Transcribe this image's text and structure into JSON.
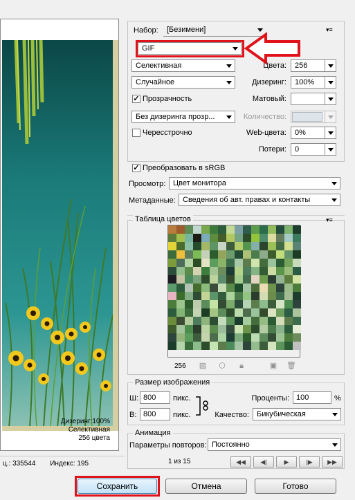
{
  "preview": {
    "dither_text": "Дизеринг:100%",
    "palette_text": "Селективная",
    "colors_text": "256 цвета"
  },
  "status_bar": {
    "left_text": "ц.: 335544",
    "index_text": "Индекс: 195"
  },
  "settings": {
    "preset_label": "Набор:",
    "preset_value": "[Безимени]",
    "format_value": "GIF",
    "reduction_value": "Селективная",
    "colors_label": "Цвета:",
    "colors_value": "256",
    "dither_algo_value": "Случайное",
    "dither_label": "Дизеринг:",
    "dither_value": "100%",
    "transparency_label": "Прозрачность",
    "transparency_checked": "✓",
    "matte_label": "Матовый:",
    "matte_value": "",
    "transp_dither_value": "Без дизеринга прозр...",
    "amount_label": "Количество:",
    "amount_value": "",
    "interlaced_label": "Чересстрочно",
    "interlaced_checked": "",
    "websnap_label": "Web-цвета:",
    "websnap_value": "0%",
    "lossy_label": "Потери:",
    "lossy_value": "0",
    "srgb_label": "Преобразовать в sRGB",
    "srgb_checked": "✓",
    "preview_label": "Просмотр:",
    "preview_value": "Цвет монитора",
    "metadata_label": "Метаданные:",
    "metadata_value": "Сведения об авт. правах и контакты"
  },
  "color_table": {
    "title": "Таблица цветов",
    "count": "256",
    "colors": [
      "#b87c3c",
      "#9c5c2c",
      "#5c8c54",
      "#c0d8d0",
      "#7aa84c",
      "#3c7a3c",
      "#2c5c3c",
      "#c4d898",
      "#7ca0a4",
      "#305c4c",
      "#5c9c4c",
      "#2c6c4c",
      "#94bc5c",
      "#244c3c",
      "#7cb470",
      "#1c3c2c",
      "#5c7c3c",
      "#a4c04c",
      "#78b4a0",
      "#1c1c14",
      "#7cacbc",
      "#5c8c3c",
      "#445c2c",
      "#b4c860",
      "#74a484",
      "#2c4c2c",
      "#94c43c",
      "#4c8c6c",
      "#dcdca0",
      "#647c5c",
      "#a4ccc4",
      "#3c7c5c",
      "#e0d438",
      "#4c6c2c",
      "#8cc0a4",
      "#244c2c",
      "#a4b868",
      "#5c9464",
      "#c8d4c4",
      "#3c5c3c",
      "#b4cc6c",
      "#54944c",
      "#84b0a8",
      "#2c442c",
      "#9cc058",
      "#446c44",
      "#d4e090",
      "#5c8474",
      "#3c6c3c",
      "#ecc03c",
      "#5c7c5c",
      "#7cbc54",
      "#c4d0b8",
      "#2c5c2c",
      "#94a45c",
      "#6c9c6c",
      "#244c34",
      "#acc078",
      "#4c7c4c",
      "#8cac8c",
      "#3c5c2c",
      "#c0dc7c",
      "#64946c",
      "#1c3c24",
      "#7c9c3c",
      "#4c6c5c",
      "#b4d4a4",
      "#2c4c24",
      "#e4e4c4",
      "#5c9c5c",
      "#8cb468",
      "#3c6c4c",
      "#a8c8a8",
      "#5c7c4c",
      "#d0e4b0",
      "#446c3c",
      "#9cc49c",
      "#2c5c34",
      "#74a45c",
      "#c8dcbc",
      "#2c4c3c",
      "#94bc8c",
      "#5c8c4c",
      "#d4d4b4",
      "#3c7c3c",
      "#a4c494",
      "#6c8c5c",
      "#1c3c34",
      "#b4d48c",
      "#4c7c5c",
      "#84b484",
      "#345c34",
      "#ccdca4",
      "#5c944c",
      "#9cbc7c",
      "#2c5c44",
      "#1c1c24",
      "#c4c4a4",
      "#4c8c5c",
      "#7ca47c",
      "#2c4c2c",
      "#bcd49c",
      "#5c8c6c",
      "#344c2c",
      "#a4cc8c",
      "#446c4c",
      "#e4d4c4",
      "#6c9c4c",
      "#2c3c34",
      "#94b494",
      "#5c7c3c",
      "#d4e4a4",
      "#5c9c6c",
      "#2c5c3c",
      "#b4c4b4",
      "#446c2c",
      "#8cbc7c",
      "#3c4c3c",
      "#c4dcb4",
      "#5c8c4c",
      "#1c4c2c",
      "#a4c4a4",
      "#4c6c3c",
      "#ecdcb4",
      "#6c944c",
      "#2c443c",
      "#9cbc8c",
      "#4c7c3c",
      "#e8b4c0",
      "#3c6c2c",
      "#84ac84",
      "#2c4c34",
      "#c4d494",
      "#5c946c",
      "#345c3c",
      "#acd49c",
      "#4c7c4c",
      "#94c484",
      "#2c3c2c",
      "#d4dcb4",
      "#6c8c4c",
      "#3c6c4c",
      "#a4bc94",
      "#1c3c2c",
      "#4c7c3c",
      "#9cc48c",
      "#2c5c2c",
      "#bcccac",
      "#5c8c5c",
      "#c4e4a4",
      "#344c34",
      "#7cac6c",
      "#2c4c3c",
      "#b4d4b4",
      "#5c7c4c",
      "#8cbc8c",
      "#3c5c3c",
      "#d4e4c4",
      "#4c8c4c",
      "#2c443c",
      "#2c5c3c",
      "#84b474",
      "#3c6c3c",
      "#c4d4b4",
      "#1c3c24",
      "#a4c484",
      "#5c8c5c",
      "#2c4c2c",
      "#bcdcac",
      "#4c6c4c",
      "#9cc49c",
      "#344c2c",
      "#dce4c4",
      "#6c9c5c",
      "#2c5c44",
      "#acc49c",
      "#6c8c3c",
      "#3c4c34",
      "#b4cc9c",
      "#4c7c5c",
      "#8cb47c",
      "#2c4c34",
      "#c4dcbc",
      "#5c945c",
      "#1c3c2c",
      "#a4cc9c",
      "#446c3c",
      "#94bc84",
      "#2c5c34",
      "#d4dcbc",
      "#5c7c4c",
      "#3c6c4c",
      "#3c5c2c",
      "#a4c49c",
      "#4c8c4c",
      "#2c3c2c",
      "#bcd4a4",
      "#5c8c4c",
      "#9cbc9c",
      "#344c3c",
      "#cce4b4",
      "#6c944c",
      "#2c4c2c",
      "#b4cca4",
      "#4c7c4c",
      "#8cb48c",
      "#2c5c3c",
      "#e4ecd4",
      "#2c443c",
      "#94b47c",
      "#5c9c5c",
      "#3c5c3c",
      "#c4d4ac",
      "#4c6c4c",
      "#acd4a4",
      "#1c3c34",
      "#7cac7c",
      "#2c5c2c",
      "#bcdcb4",
      "#5c8c5c",
      "#344c34",
      "#9cc494",
      "#4c7c3c",
      "#6c8c5c",
      "#1c3c2c",
      "#b4d4ac",
      "#3c6c3c",
      "#8cbc8c",
      "#2c4c2c",
      "#c4e4b4",
      "#5c7c4c",
      "#4c8c5c",
      "#a4c4a4",
      "#2c443c",
      "#94bc8c",
      "#3c5c3c",
      "#d4e4bc",
      "#5c945c",
      "#2c5c34",
      "#c0c0c0"
    ]
  },
  "image_size": {
    "title": "Размер изображения",
    "w_label": "Ш:",
    "w_value": "800",
    "h_label": "В:",
    "h_value": "800",
    "unit": "пикс.",
    "percent_label": "Проценты:",
    "percent_value": "100",
    "percent_sign": "%",
    "quality_label": "Качество:",
    "quality_value": "Бикубическая"
  },
  "animation": {
    "title": "Анимация",
    "loop_label": "Параметры повторов:",
    "loop_value": "Постоянно",
    "frame_text": "1 из 15"
  },
  "buttons": {
    "save": "Сохранить",
    "cancel": "Отмена",
    "done": "Готово"
  },
  "colors": {
    "highlight": "#e0131b",
    "primary_button": "#3c7fb1"
  }
}
